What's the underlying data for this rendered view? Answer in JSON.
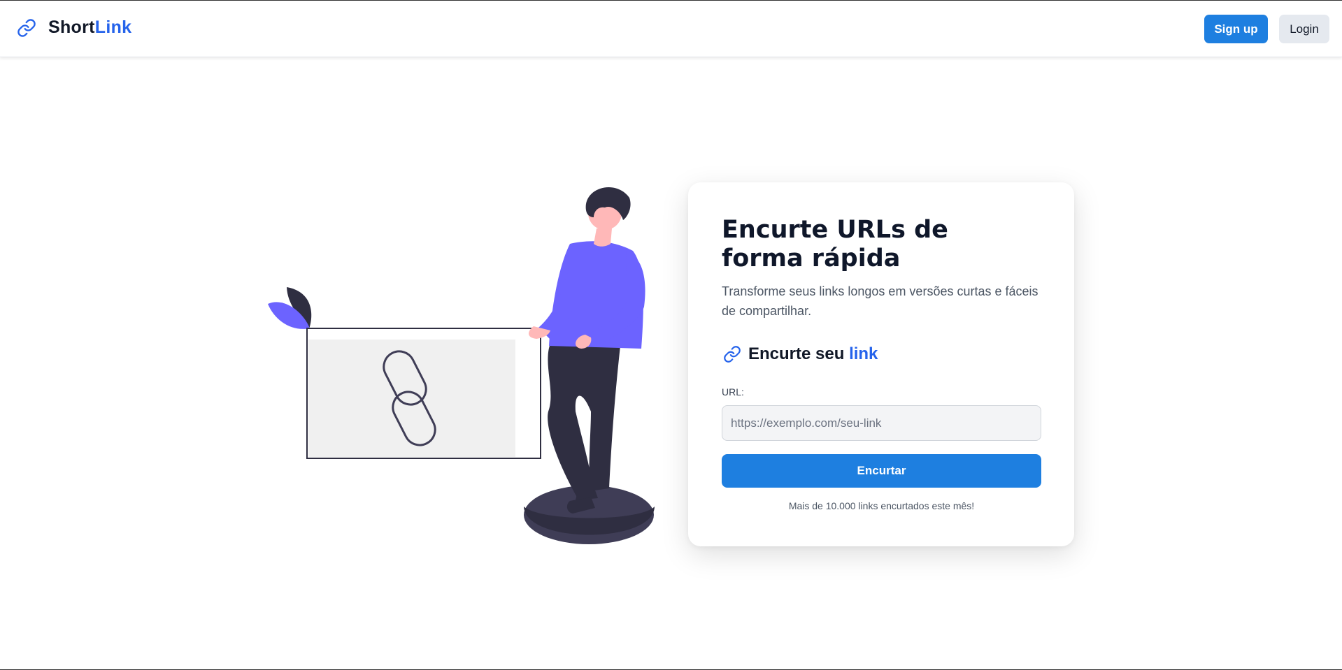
{
  "header": {
    "brand": {
      "part1": "Short",
      "part2": "Link",
      "icon": "link-icon"
    },
    "signup_label": "Sign up",
    "login_label": "Login"
  },
  "hero": {
    "title": "Encurte URLs de forma rápida",
    "subtitle": "Transforme seus links longos em versões curtas e fáceis de compartilhar.",
    "section": {
      "title_prefix": "Encurte seu",
      "title_highlight": "link",
      "icon": "link-icon"
    },
    "url_label": "URL:",
    "url_placeholder": "https://exemplo.com/seu-link",
    "url_value": "",
    "submit_label": "Encurtar",
    "footnote": "Mais de 10.000 links encurtados este mês!"
  },
  "colors": {
    "accent": "#1e7fe0",
    "brand_blue": "#2563eb",
    "illustration_purple": "#6c63ff",
    "illustration_dark": "#2f2e41"
  }
}
